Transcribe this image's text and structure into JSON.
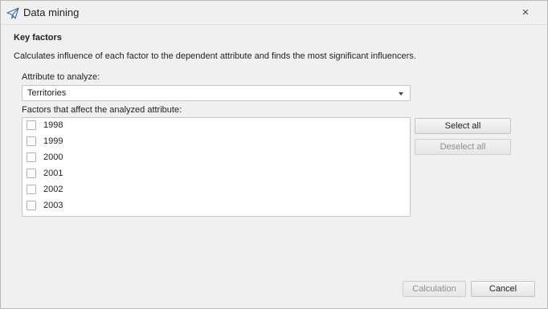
{
  "window": {
    "title": "Data mining",
    "icon": "paper-plane-icon",
    "close_label": "×"
  },
  "section": {
    "title": "Key factors",
    "description": "Calculates influence of each factor to the dependent attribute and finds the most significant influencers."
  },
  "attribute": {
    "label": "Attribute to analyze:",
    "selected": "Territories"
  },
  "factors": {
    "label": "Factors that affect the analyzed attribute:",
    "items": [
      {
        "label": "1998",
        "checked": false
      },
      {
        "label": "1999",
        "checked": false
      },
      {
        "label": "2000",
        "checked": false
      },
      {
        "label": "2001",
        "checked": false
      },
      {
        "label": "2002",
        "checked": false
      },
      {
        "label": "2003",
        "checked": false
      }
    ]
  },
  "buttons": {
    "select_all": "Select all",
    "deselect_all": "Deselect all",
    "calculation": "Calculation",
    "cancel": "Cancel"
  },
  "colors": {
    "icon_accent": "#3f6ea8",
    "disabled_text": "#8f8f8f"
  }
}
